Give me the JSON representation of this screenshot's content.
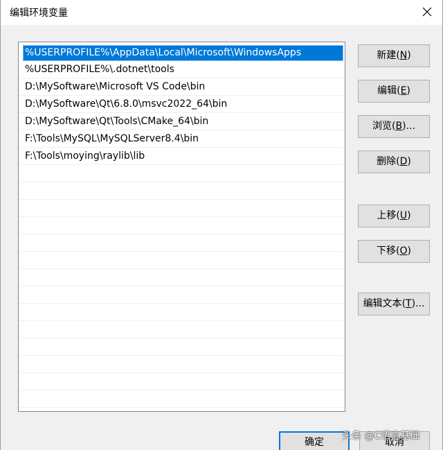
{
  "window": {
    "title": "编辑环境变量",
    "close_icon": "close-icon"
  },
  "list": {
    "items": [
      "%USERPROFILE%\\AppData\\Local\\Microsoft\\WindowsApps",
      "%USERPROFILE%\\.dotnet\\tools",
      "D:\\MySoftware\\Microsoft VS Code\\bin",
      "D:\\MySoftware\\Qt\\6.8.0\\msvc2022_64\\bin",
      "D:\\MySoftware\\Qt\\Tools\\CMake_64\\bin",
      "F:\\Tools\\MySQL\\MySQLServer8.4\\bin",
      "F:\\Tools\\moying\\raylib\\lib"
    ],
    "selected_index": 0
  },
  "buttons": {
    "new": {
      "label": "新建",
      "key": "N"
    },
    "edit": {
      "label": "编辑",
      "key": "E"
    },
    "browse": {
      "label": "浏览",
      "key": "B",
      "suffix": "..."
    },
    "delete": {
      "label": "删除",
      "key": "D"
    },
    "move_up": {
      "label": "上移",
      "key": "U"
    },
    "move_down": {
      "label": "下移",
      "key": "O"
    },
    "edit_text": {
      "label": "编辑文本",
      "key": "T",
      "suffix": "..."
    }
  },
  "footer": {
    "ok_label": "确定",
    "cancel_label": "取消"
  },
  "watermark": "头条 @C语言基础"
}
